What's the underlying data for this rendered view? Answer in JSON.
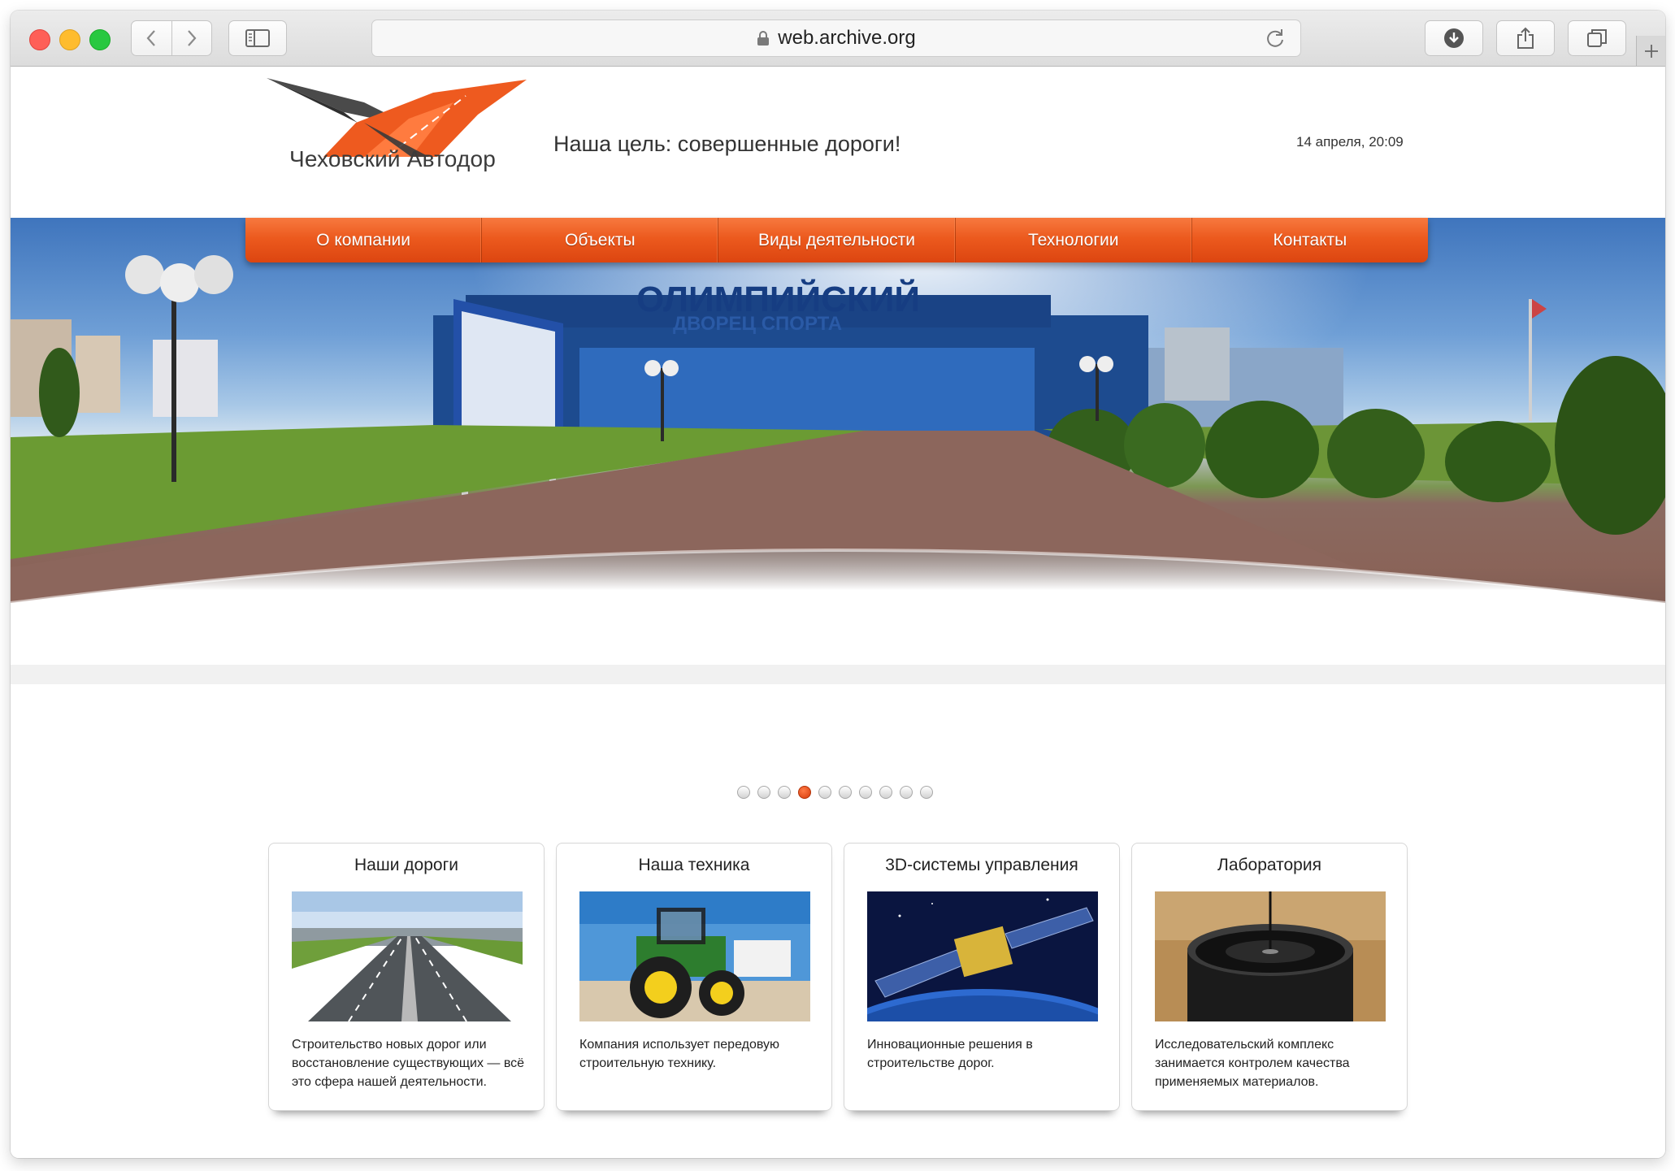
{
  "browser": {
    "url": "web.archive.org",
    "icons": {
      "back": "chevron-left-icon",
      "forward": "chevron-right-icon",
      "sidebar": "sidebar-icon",
      "lock": "lock-icon",
      "reload": "reload-icon",
      "download": "download-icon",
      "share": "share-icon",
      "tabs": "tabs-icon",
      "new_tab": "plus-icon"
    }
  },
  "header": {
    "logo_text": "Чеховский Автодор",
    "tagline": "Наша цель: совершенные дороги!",
    "datetime": "14 апреля, 20:09"
  },
  "nav": [
    {
      "label": "О компании"
    },
    {
      "label": "Объекты"
    },
    {
      "label": "Виды деятельности"
    },
    {
      "label": "Технологии"
    },
    {
      "label": "Контакты"
    }
  ],
  "slider": {
    "caption": "Дворец Спорта «Олимпийский»",
    "building_sign": "ОЛИМПИЙСКИЙ",
    "building_subsign": "ДВОРЕЦ СПОРТА",
    "slide_count": 10,
    "active_slide": 4
  },
  "cards": [
    {
      "title": "Наши дороги",
      "image": "highway-photo",
      "text": "Строительство новых дорог или восстановление существующих — всё это сфера нашей деятельности."
    },
    {
      "title": "Наша техника",
      "image": "tractor-photo",
      "text": "Компания использует передовую строительную технику."
    },
    {
      "title": "3D-системы управления",
      "image": "satellite-photo",
      "text": "Инновационные решения в строительстве дорог."
    },
    {
      "title": "Лаборатория",
      "image": "laboratory-photo",
      "text": "Исследовательский комплекс занимается контролем качества применяемых материалов."
    }
  ],
  "colors": {
    "accent": "#ec5a1e",
    "accent_dark": "#dc4510",
    "logo_grey": "#3b3b3b"
  }
}
